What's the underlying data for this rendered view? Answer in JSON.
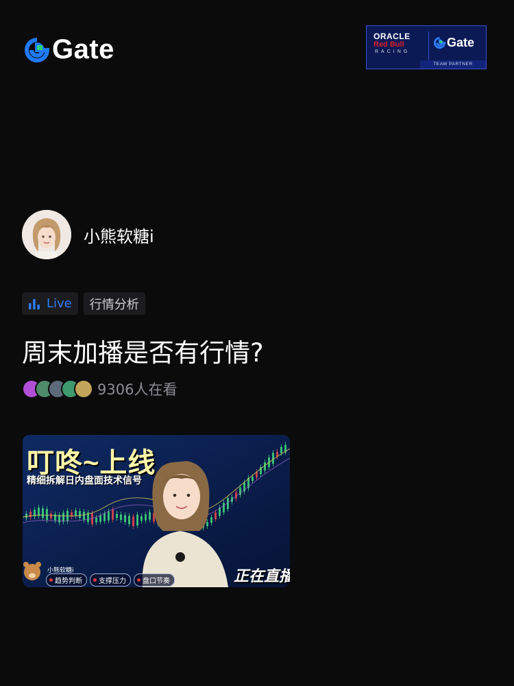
{
  "brand": {
    "name": "Gate",
    "accent": "#1f7af6"
  },
  "partner": {
    "line1": "ORACLE",
    "line2": "Red Bull",
    "line3": "RACING",
    "gate": "Gate",
    "footer": "TEAM PARTNER"
  },
  "author": {
    "name": "小熊软糖i",
    "avatar": "avatar-photo"
  },
  "tags": [
    {
      "label": "Live",
      "icon": "bar-chart-icon",
      "color": "#2f7cf6"
    },
    {
      "label": "行情分析"
    }
  ],
  "post": {
    "title": "周末加播是否有行情?"
  },
  "viewers": {
    "count_text": "9306人在看",
    "avatar_colors": [
      "#b14fd6",
      "#4f8a6a",
      "#5b6b7a",
      "#3e9a6e",
      "#c2a45a"
    ]
  },
  "thumbnail": {
    "headline": "叮咚~上线",
    "subtitle": "精细拆解日内盘面技术信号",
    "host": "小熊软糖i",
    "chips": [
      "趋势判断",
      "支撑压力",
      "盘口节奏"
    ],
    "badge": "正在直播"
  }
}
